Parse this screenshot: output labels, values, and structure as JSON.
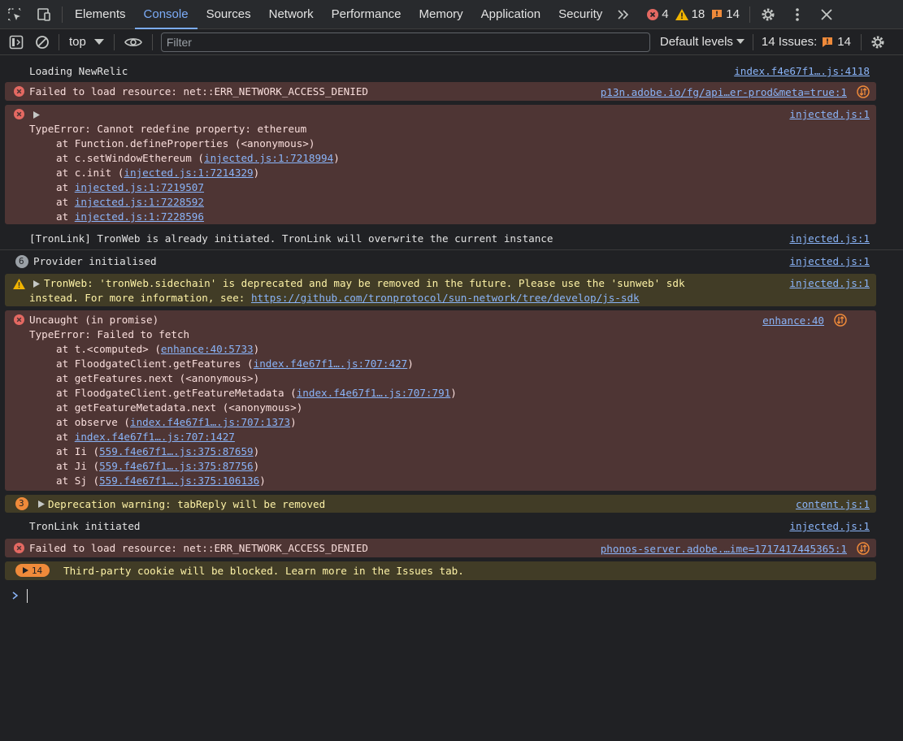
{
  "tabs": {
    "elements": "Elements",
    "console": "Console",
    "sources": "Sources",
    "network": "Network",
    "performance": "Performance",
    "memory": "Memory",
    "application": "Application",
    "security": "Security"
  },
  "counts": {
    "errors": "4",
    "warnings": "18",
    "issues": "14"
  },
  "toolbar": {
    "context": "top",
    "filter_placeholder": "Filter",
    "levels": "Default levels",
    "issues_label": "14 Issues:",
    "issues_count": "14"
  },
  "messages": {
    "m1": {
      "text": "Loading NewRelic",
      "source": "index.f4e67f1….js:4118"
    },
    "m2": {
      "text": "Failed to load resource: net::ERR_NETWORK_ACCESS_DENIED",
      "source": "p13n.adobe.io/fg/api…er-prod&meta=true:1"
    },
    "m3": {
      "source": "injected.js:1",
      "title": "TypeError: Cannot redefine property: ethereum",
      "s1": "at Function.defineProperties (<anonymous>)",
      "s2a": "at c.setWindowEthereum (",
      "s2l": "injected.js:1:7218994",
      "s2b": ")",
      "s3a": "at c.init (",
      "s3l": "injected.js:1:7214329",
      "s3b": ")",
      "s4a": "at ",
      "s4l": "injected.js:1:7219507",
      "s5a": "at ",
      "s5l": "injected.js:1:7228592",
      "s6a": "at ",
      "s6l": "injected.js:1:7228596"
    },
    "m4": {
      "text": "[TronLink] TronWeb is already initiated. TronLink will overwrite the current instance",
      "source": "injected.js:1"
    },
    "m5": {
      "badge": "6",
      "text": "Provider initialised",
      "source": "injected.js:1"
    },
    "m6": {
      "line1": "TronWeb: 'tronWeb.sidechain' is deprecated and may be removed in the future. Please use the 'sunweb' sdk",
      "line2a": "instead. For more information, see: ",
      "line2l": "https://github.com/tronprotocol/sun-network/tree/develop/js-sdk",
      "source": "injected.js:1"
    },
    "m7": {
      "source": "enhance:40",
      "l1": "Uncaught (in promise)",
      "l2": "TypeError: Failed to fetch",
      "s1a": "at t.<computed> (",
      "s1l": "enhance:40:5733",
      "s1b": ")",
      "s2a": "at FloodgateClient.getFeatures (",
      "s2l": "index.f4e67f1….js:707:427",
      "s2b": ")",
      "s3a": "at getFeatures.next (<anonymous>)",
      "s4a": "at FloodgateClient.getFeatureMetadata (",
      "s4l": "index.f4e67f1….js:707:791",
      "s4b": ")",
      "s5a": "at getFeatureMetadata.next (<anonymous>)",
      "s6a": "at observe (",
      "s6l": "index.f4e67f1….js:707:1373",
      "s6b": ")",
      "s7a": "at ",
      "s7l": "index.f4e67f1….js:707:1427",
      "s8a": "at Ii (",
      "s8l": "559.f4e67f1….js:375:87659",
      "s8b": ")",
      "s9a": "at Ji (",
      "s9l": "559.f4e67f1….js:375:87756",
      "s9b": ")",
      "s10a": "at Sj (",
      "s10l": "559.f4e67f1….js:375:106136",
      "s10b": ")"
    },
    "m8": {
      "badge": "3",
      "text": "Deprecation warning: tabReply will be removed",
      "source": "content.js:1"
    },
    "m9": {
      "text": "TronLink initiated",
      "source": "injected.js:1"
    },
    "m10": {
      "text": "Failed to load resource: net::ERR_NETWORK_ACCESS_DENIED",
      "source": "phonos-server.adobe.…ime=1717417445365:1"
    },
    "m11": {
      "badge": "14",
      "text": "Third-party cookie will be blocked. Learn more in the Issues tab."
    }
  },
  "colors": {
    "error": "#e46962",
    "warning": "#f0b400",
    "link": "#8ab4f8",
    "active_tab": "#7cacf8",
    "issue": "#ef8a3a"
  }
}
